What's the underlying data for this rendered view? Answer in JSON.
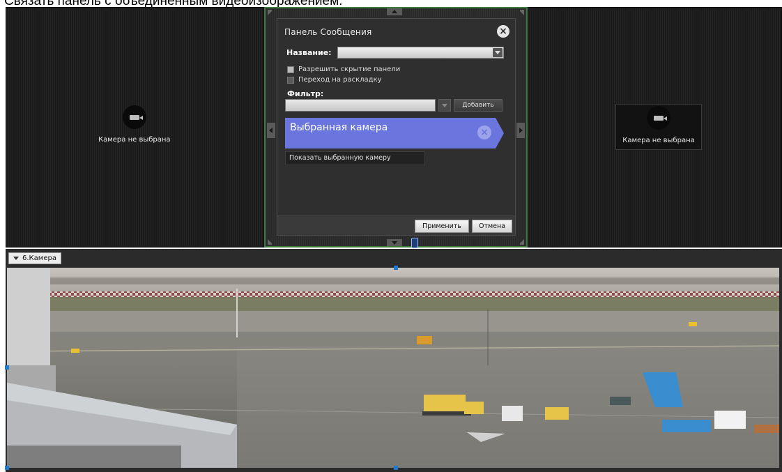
{
  "caption": "Связать панель с объединенным видеоизображением.",
  "cells": {
    "left": {
      "status": "Камера не выбрана"
    },
    "right": {
      "status": "Камера не выбрана"
    }
  },
  "dialog": {
    "title": "Панель Сообщения",
    "name_label": "Название:",
    "name_value": "",
    "allow_hide_label": "Разрешить скрытие панели",
    "goto_layout_label": "Переход на раскладку",
    "filter_label": "Фильтр:",
    "filter_value": "",
    "add_button": "Добавить",
    "selected_camera_label": "Выбранная камера",
    "show_selected_button": "Показать выбранную камеру",
    "apply_button": "Применить",
    "cancel_button": "Отмена"
  },
  "camera": {
    "title": "6.Камера"
  },
  "colors": {
    "selected_block": "#6a76dd",
    "cell_border_active": "#3d7a3d",
    "selection_handle": "#1f78d1"
  },
  "icons": [
    "camera-icon",
    "close-icon",
    "dropdown-arrow-icon",
    "remove-icon",
    "link-icon",
    "collapse-icon"
  ]
}
